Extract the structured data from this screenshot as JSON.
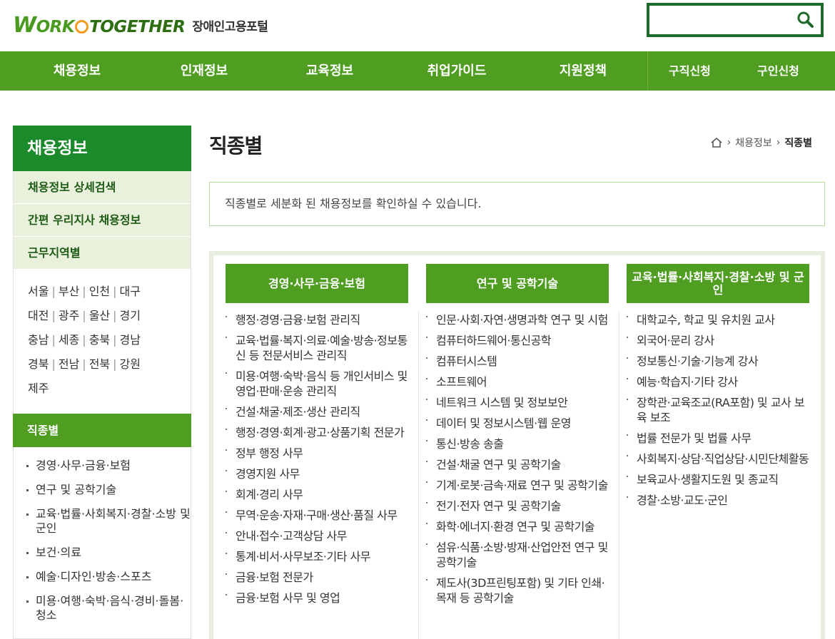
{
  "header": {
    "logo_text_w": "W",
    "logo_text_ork": "ORK",
    "logo_text_together": "TOGETHER",
    "logo_sub": "장애인고용포털",
    "search_placeholder": ""
  },
  "gnb": {
    "items": [
      "채용정보",
      "인재정보",
      "교육정보",
      "취업가이드",
      "지원정책"
    ],
    "right_items": [
      "구직신청",
      "구인신청"
    ]
  },
  "lnb": {
    "title": "채용정보",
    "menu": [
      "채용정보 상세검색",
      "간편 우리지사 채용정보",
      "근무지역별"
    ],
    "regions": [
      [
        "서울",
        "부산",
        "인천",
        "대구"
      ],
      [
        "대전",
        "광주",
        "울산",
        "경기"
      ],
      [
        "충남",
        "세종",
        "충북",
        "경남"
      ],
      [
        "경북",
        "전남",
        "전북",
        "강원"
      ],
      [
        "제주"
      ]
    ],
    "sub_title": "직종별",
    "jobs": [
      "경영·사무·금융·보험",
      "연구 및 공학기술",
      "교육·법률·사회복지·경찰·소방 및 군인",
      "보건·의료",
      "예술·디자인·방송·스포츠",
      "미용·여행·숙박·음식·경비·돌봄·청소"
    ]
  },
  "content": {
    "title": "직종별",
    "breadcrumb": [
      "채용정보",
      "직종별"
    ],
    "notice": "직종별로 세분화 된 채용정보를 확인하실 수 있습니다."
  },
  "categories": [
    {
      "head": "경영·사무·금융·보험",
      "items": [
        "행정·경영·금융·보험 관리직",
        "교육·법률·복지·의료·예술·방송·정보통신 등 전문서비스 관리직",
        "미용·여행·숙박·음식 등 개인서비스 및 영업·판매·운송 관리직",
        "건설·채굴·제조·생산 관리직",
        "행정·경영·회계·광고·상품기획 전문가",
        "정부 행정 사무",
        "경영지원 사무",
        "회계·경리 사무",
        "무역·운송·자재·구매·생산·품질 사무",
        "안내·접수·고객상담 사무",
        "통계·비서·사무보조·기타 사무",
        "금융·보험 전문가",
        "금융·보험 사무 및 영업"
      ]
    },
    {
      "head": "연구 및 공학기술",
      "items": [
        "인문·사회·자연·생명과학 연구 및 시험",
        "컴퓨터하드웨어·통신공학",
        "컴퓨터시스템",
        "소프트웨어",
        "네트워크 시스템 및 정보보안",
        "데이터 및 정보시스템·웹 운영",
        "통신·방송 송출",
        "건설·채굴 연구 및 공학기술",
        "기계·로봇·금속·재료 연구 및 공학기술",
        "전기·전자 연구 및 공학기술",
        "화학·에너지·환경 연구 및 공학기술",
        "섬유·식품·소방·방재·산업안전 연구 및 공학기술",
        "제도사(3D프린팅포함) 및 기타 인쇄·목재 등 공학기술"
      ]
    },
    {
      "head": "교육·법률·사회복지·경찰·소방 및 군인",
      "items": [
        "대학교수, 학교 및 유치원 교사",
        "외국어·문리 강사",
        "정보통신·기술·기능계 강사",
        "예능·학습지·기타 강사",
        "장학관·교육조교(RA포함) 및 교사 보육 보조",
        "법률 전문가 및 법률 사무",
        "사회복지·상담·직업상담·시민단체활동",
        "보육교사·생활지도원 및 종교직",
        "경찰·소방·교도·군인"
      ]
    }
  ],
  "colors": {
    "nav_green": "#4f9d21",
    "lnb_title_green": "#1a8a2b",
    "search_border": "#1e6a2a"
  }
}
